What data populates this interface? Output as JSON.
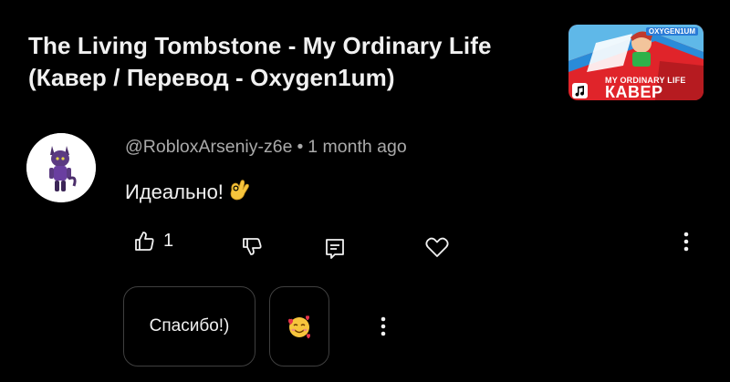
{
  "video": {
    "title_line1": "The Living Tombstone - My Ordinary Life",
    "title_line2": "(Кавер / Перевод - Oxygen1um)",
    "thumbnail": {
      "brand": "OXYGEN1UM",
      "subtitle": "MY ORDINARY LIFE",
      "main": "КАВЕР",
      "colors": {
        "background": "#e0242a",
        "sky": "#5fb8e8",
        "stripe": "#2a8bd8"
      }
    }
  },
  "comment": {
    "author": "@RobloxArseniy-z6e",
    "separator": "•",
    "time": "1 month ago",
    "text": "Идеально!",
    "text_emoji": "ok-hand-emoji",
    "likes": "1"
  },
  "actions": {
    "like_icon": "thumbs-up-icon",
    "dislike_icon": "thumbs-down-icon",
    "reply_icon": "reply-icon",
    "heart_icon": "heart-icon",
    "more_icon": "more-vertical-icon"
  },
  "suggested_replies": {
    "text_chip": "Спасибо!)",
    "emoji_chip": "smiling-face-with-hearts-emoji"
  },
  "colors": {
    "background": "#000000",
    "primary_text": "#f1f1f1",
    "secondary_text": "#aaaaaa",
    "chip_border": "#3f3f3f"
  }
}
